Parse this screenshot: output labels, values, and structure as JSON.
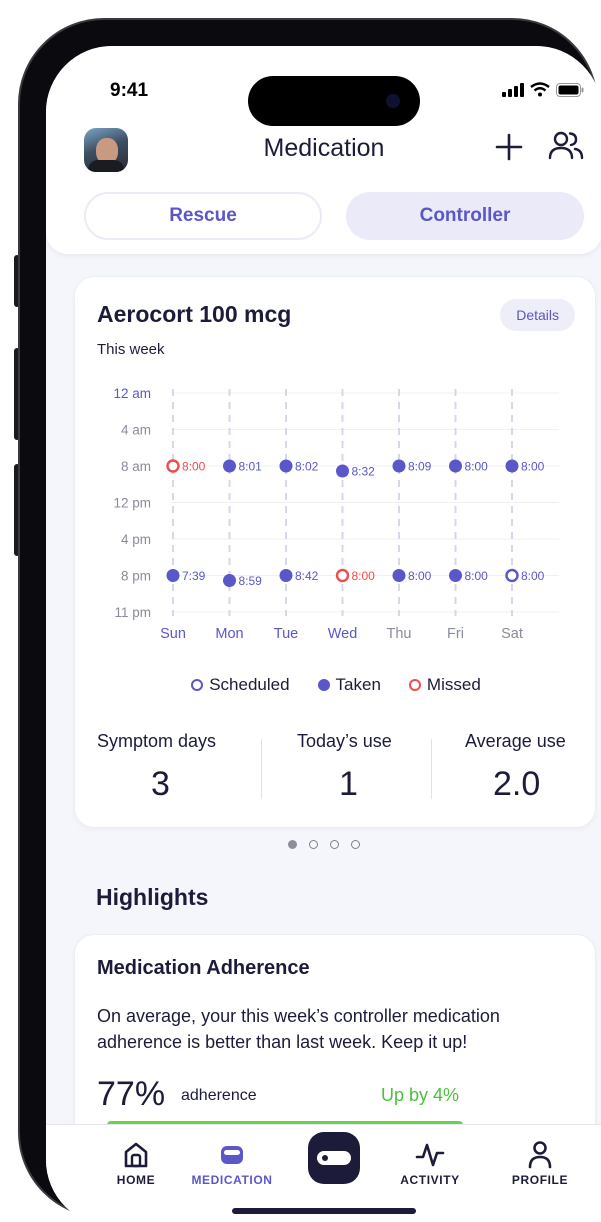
{
  "status": {
    "time": "9:41"
  },
  "header": {
    "title": "Medication"
  },
  "segments": {
    "rescue": "Rescue",
    "controller": "Controller",
    "selected": "Controller"
  },
  "medication": {
    "name": "Aerocort 100 mcg",
    "details_label": "Details",
    "period_label": "This week"
  },
  "colors": {
    "accent": "#5a57c8",
    "taken": "#5a57c8",
    "missed": "#ef4d4d",
    "scheduled": "#5a57c8",
    "positive": "#4cc13d"
  },
  "chart_data": {
    "type": "scatter",
    "title": "",
    "xlabel": "",
    "ylabel": "",
    "days": [
      "Sun",
      "Mon",
      "Tue",
      "Wed",
      "Thu",
      "Fri",
      "Sat"
    ],
    "y_ticks": [
      "12 am",
      "4 am",
      "8 am",
      "12 pm",
      "4 pm",
      "8 pm",
      "11 pm"
    ],
    "ylim": [
      "12 am",
      "11 pm"
    ],
    "grid": true,
    "series": [
      {
        "name": "Scheduled",
        "points": [
          {
            "day": "Sat",
            "time": "8:00",
            "slot": "8 pm"
          }
        ]
      },
      {
        "name": "Taken",
        "points": [
          {
            "day": "Mon",
            "time": "8:01",
            "slot": "8 am"
          },
          {
            "day": "Tue",
            "time": "8:02",
            "slot": "8 am"
          },
          {
            "day": "Wed",
            "time": "8:32",
            "slot": "8 am"
          },
          {
            "day": "Thu",
            "time": "8:09",
            "slot": "8 am"
          },
          {
            "day": "Fri",
            "time": "8:00",
            "slot": "8 am"
          },
          {
            "day": "Sat",
            "time": "8:00",
            "slot": "8 am"
          },
          {
            "day": "Sun",
            "time": "7:39",
            "slot": "8 pm"
          },
          {
            "day": "Mon",
            "time": "8:59",
            "slot": "8 pm"
          },
          {
            "day": "Tue",
            "time": "8:42",
            "slot": "8 pm"
          },
          {
            "day": "Thu",
            "time": "8:00",
            "slot": "8 pm"
          },
          {
            "day": "Fri",
            "time": "8:00",
            "slot": "8 pm"
          }
        ]
      },
      {
        "name": "Missed",
        "points": [
          {
            "day": "Sun",
            "time": "8:00",
            "slot": "8 am"
          },
          {
            "day": "Wed",
            "time": "8:00",
            "slot": "8 pm"
          }
        ]
      }
    ]
  },
  "legend": {
    "scheduled": "Scheduled",
    "taken": "Taken",
    "missed": "Missed"
  },
  "stats": {
    "symptom_days": {
      "label": "Symptom days",
      "value": "3"
    },
    "todays_use": {
      "label": "Today’s use",
      "value": "1"
    },
    "average_use": {
      "label": "Average use",
      "value": "2.0"
    }
  },
  "pager": {
    "count": 4,
    "active": 1
  },
  "highlights": {
    "title": "Highlights",
    "adherence": {
      "title": "Medication Adherence",
      "body": "On average, your this week’s controller medication adherence is better than last week. Keep it up!",
      "percent": "77%",
      "label": "adherence",
      "trend": "Up by 4%",
      "progress": 0.77
    }
  },
  "tabs": [
    {
      "label": "HOME",
      "icon": "home-icon"
    },
    {
      "label": "MEDICATION",
      "icon": "medication-icon"
    },
    {
      "label": "",
      "icon": "inhaler-icon"
    },
    {
      "label": "ACTIVITY",
      "icon": "activity-icon"
    },
    {
      "label": "PROFILE",
      "icon": "profile-icon"
    }
  ]
}
